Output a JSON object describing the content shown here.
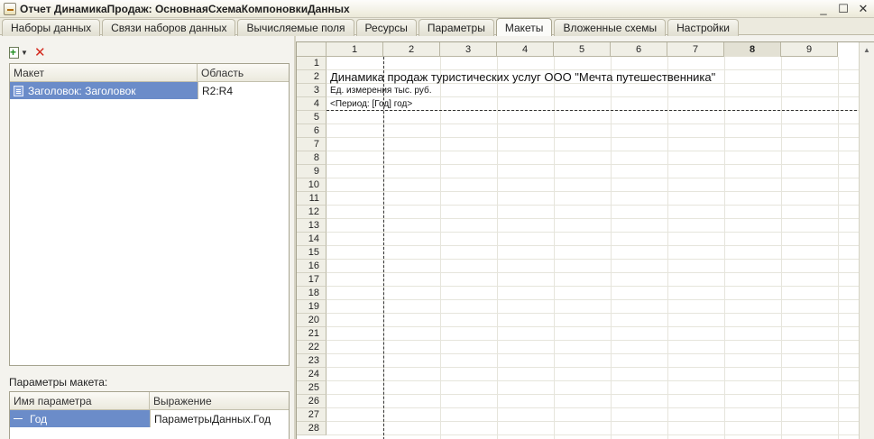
{
  "window": {
    "title": "Отчет ДинамикаПродаж: ОсновнаяСхемаКомпоновкиДанных",
    "controls": {
      "minimize": "_",
      "maximize": "☐",
      "close": "✕"
    }
  },
  "tabs": [
    {
      "label": "Наборы данных"
    },
    {
      "label": "Связи наборов данных"
    },
    {
      "label": "Вычисляемые поля"
    },
    {
      "label": "Ресурсы"
    },
    {
      "label": "Параметры"
    },
    {
      "label": "Макеты",
      "active": true
    },
    {
      "label": "Вложенные схемы"
    },
    {
      "label": "Настройки"
    }
  ],
  "layouts_grid": {
    "columns": [
      "Макет",
      "Область"
    ],
    "rows": [
      {
        "layout": "Заголовок: Заголовок",
        "area": "R2:R4",
        "icon": "layout-icon"
      }
    ]
  },
  "params": {
    "label": "Параметры макета:",
    "columns": [
      "Имя параметра",
      "Выражение"
    ],
    "rows": [
      {
        "name": "Год",
        "expression": "ПараметрыДанных.Год"
      }
    ]
  },
  "sheet": {
    "columns": [
      "1",
      "2",
      "3",
      "4",
      "5",
      "6",
      "7",
      "8",
      "9"
    ],
    "selected_column": "8",
    "rows": [
      "1",
      "2",
      "3",
      "4",
      "5",
      "6",
      "7",
      "8",
      "9",
      "10",
      "11",
      "12",
      "13",
      "14",
      "15",
      "16",
      "17",
      "18",
      "19",
      "20",
      "21",
      "22",
      "23",
      "24",
      "25",
      "26",
      "27",
      "28"
    ],
    "cells": {
      "r2": "Динамика продаж туристических услуг ООО  \"Мечта путешественника\"",
      "r3": "Ед. измерения тыс. руб.",
      "r4": "<Период: [Год] год>"
    }
  },
  "colors": {
    "selection": "#6b8cc9",
    "delete_icon": "#d42a1f",
    "add_icon": "#1f8f1f"
  }
}
